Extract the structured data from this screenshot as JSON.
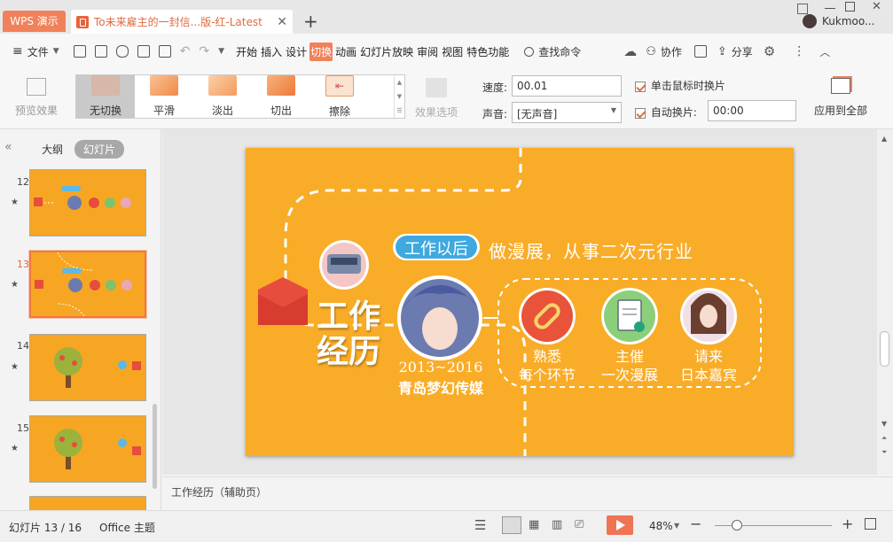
{
  "titlebar": {
    "app_tab": "WPS 演示",
    "doc_tab": "To未来雇主的一封信...版-红-Latest",
    "new_tab": "+",
    "user": "Kukmoo..."
  },
  "toolbar": {
    "file_menu": "文件",
    "tabs": [
      "开始",
      "插入",
      "设计",
      "切换",
      "动画",
      "幻灯片放映",
      "审阅",
      "视图",
      "特色功能"
    ],
    "active_tab": "切换",
    "search": "查找命令",
    "collab": "协作",
    "share": "分享"
  },
  "ribbon": {
    "preview": "预览效果",
    "effects": [
      "无切换",
      "平滑",
      "淡出",
      "切出",
      "擦除"
    ],
    "effect_options": "效果选项",
    "speed_label": "速度:",
    "speed_value": "00.01",
    "sound_label": "声音:",
    "sound_value": "[无声音]",
    "click_advance": "单击鼠标时换片",
    "auto_advance": "自动换片:",
    "auto_time": "00:00",
    "apply_all": "应用到全部"
  },
  "left_panel": {
    "tab_outline": "大纲",
    "tab_slides": "幻灯片",
    "slide_numbers": [
      "12",
      "13",
      "14",
      "15"
    ],
    "selected": "13",
    "thumb_label": "工作经历"
  },
  "slide": {
    "title": "工作\n经历",
    "title_l1": "工作",
    "title_l2": "经历",
    "badge": "工作以后",
    "subtitle": "做漫展，从事二次元行业",
    "years": "2013~2016",
    "company": "青岛梦幻传媒",
    "items": [
      {
        "l1": "熟悉",
        "l2": "每个环节"
      },
      {
        "l1": "主催",
        "l2": "一次漫展"
      },
      {
        "l1": "请来",
        "l2": "日本嘉宾"
      }
    ],
    "colors": {
      "bg": "#f9ac27",
      "red": "#e84c3d",
      "green": "#7ec26c",
      "white": "#ffffff"
    }
  },
  "notes": "工作经历（辅助页）",
  "status": {
    "slide_counter": "幻灯片 13 / 16",
    "theme": "Office 主题",
    "zoom": "48%",
    "zoom_minus": "−",
    "zoom_plus": "+"
  }
}
